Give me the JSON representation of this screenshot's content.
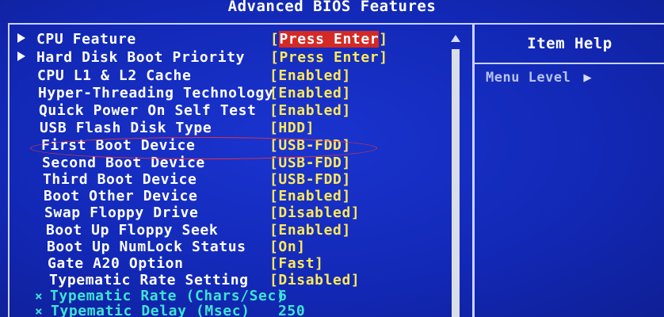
{
  "title": "Advanced BIOS Features",
  "help": {
    "title": "Item Help",
    "menu_level_label": "Menu Level",
    "menu_level_arrow": "▶"
  },
  "items": [
    {
      "label": "CPU Feature",
      "value": "Press Enter",
      "submenu": true,
      "selected": true
    },
    {
      "label": "Hard Disk Boot Priority",
      "value": "Press Enter",
      "submenu": true
    },
    {
      "label": "CPU L1 & L2 Cache",
      "value": "[Enabled]"
    },
    {
      "label": "Hyper-Threading Technology",
      "value": "[Enabled]"
    },
    {
      "label": "Quick Power On Self Test",
      "value": "[Enabled]"
    },
    {
      "label": "USB Flash Disk Type",
      "value": "[HDD]"
    },
    {
      "label": "First Boot Device",
      "value": "[USB-FDD]",
      "highlighted": true
    },
    {
      "label": "Second Boot Device",
      "value": "[USB-FDD]"
    },
    {
      "label": "Third Boot Device",
      "value": "[USB-FDD]"
    },
    {
      "label": "Boot Other Device",
      "value": "[Enabled]"
    },
    {
      "label": "Swap Floppy Drive",
      "value": "[Disabled]"
    },
    {
      "label": "Boot Up Floppy Seek",
      "value": "[Enabled]"
    },
    {
      "label": "Boot Up NumLock Status",
      "value": "[On]"
    },
    {
      "label": "Gate A20 Option",
      "value": "[Fast]"
    },
    {
      "label": "Typematic Rate Setting",
      "value": "[Disabled]"
    },
    {
      "label": "Typematic Rate (Chars/Sec)",
      "value": "6",
      "disabled": true
    },
    {
      "label": "Typematic Delay (Msec)",
      "value": "250",
      "disabled": true
    }
  ],
  "scroll_up_icon": "triangle-up",
  "colors": {
    "background": "#1429b8",
    "label": "#ffffff",
    "value": "#ffe85a",
    "selected_bg": "#d42a25",
    "disabled_text": "#3fe3d2",
    "annotation_oval": "#e23344"
  }
}
